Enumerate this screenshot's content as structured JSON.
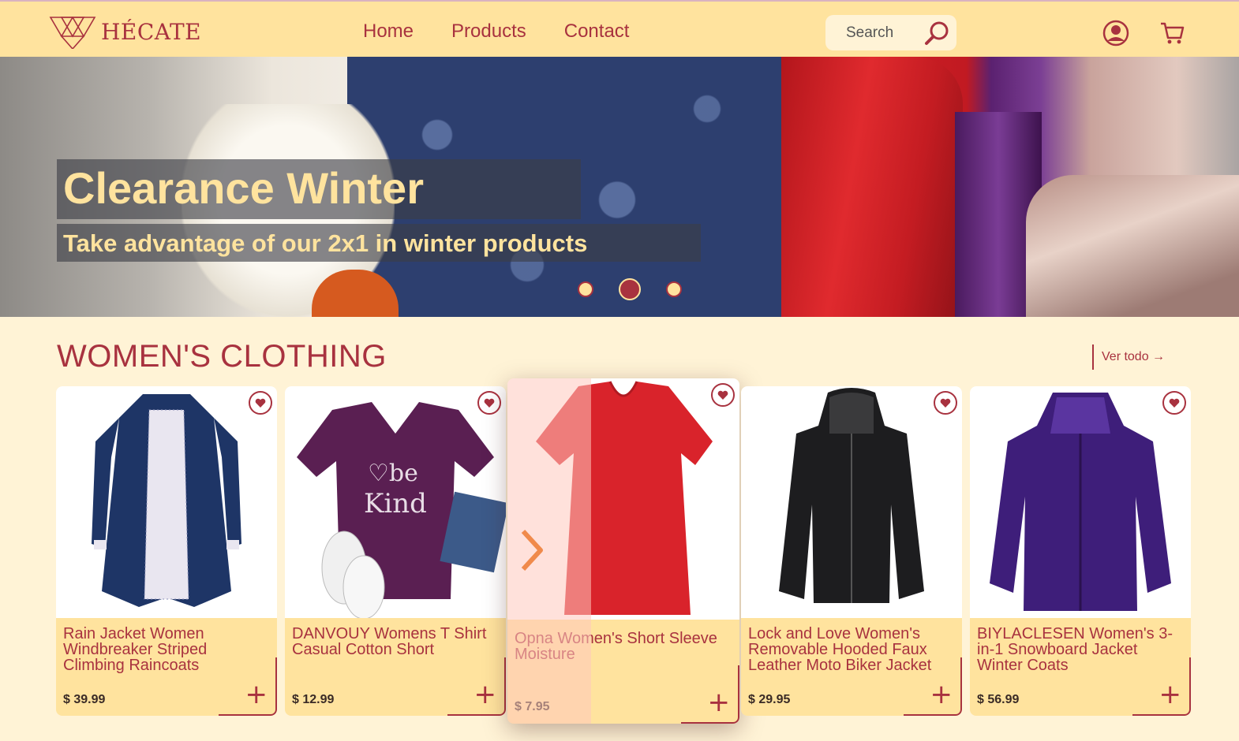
{
  "brand": {
    "name": "HÉCATE"
  },
  "nav": {
    "items": [
      "Home",
      "Products",
      "Contact"
    ]
  },
  "search": {
    "placeholder": "Search"
  },
  "hero": {
    "title": "Clearance Winter",
    "subtitle": "Take advantage of our 2x1 in winter products",
    "slides": 3,
    "active_slide": 2
  },
  "section": {
    "title": "WOMEN'S CLOTHING",
    "link": "Ver todo →"
  },
  "products": [
    {
      "name": "Rain Jacket Women Windbreaker Striped Climbing Raincoats",
      "price": "$ 39.99"
    },
    {
      "name": "DANVOUY Womens T Shirt Casual Cotton Short",
      "price": "$ 12.99"
    },
    {
      "name": "Opna Women's Short Sleeve Moisture",
      "price": "$ 7.95"
    },
    {
      "name": "Lock and Love Women's Removable Hooded Faux Leather Moto Biker Jacket",
      "price": "$ 29.95"
    },
    {
      "name": "BIYLACLESEN Women's 3-in-1 Snowboard Jacket Winter Coats",
      "price": "$ 56.99"
    }
  ],
  "add_label": "+",
  "colors": {
    "accent": "#a8323f",
    "header": "#ffe39e",
    "background": "#fff3d6"
  }
}
